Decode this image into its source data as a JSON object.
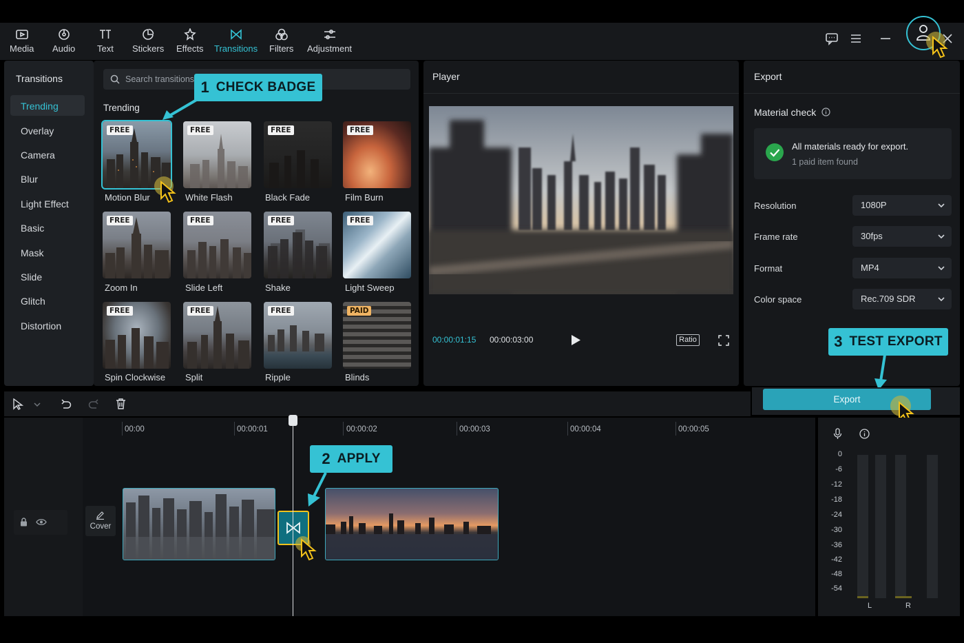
{
  "toolbar": {
    "items": [
      {
        "label": "Media",
        "icon": "media-icon",
        "active": false
      },
      {
        "label": "Audio",
        "icon": "audio-icon",
        "active": false
      },
      {
        "label": "Text",
        "icon": "text-icon",
        "active": false
      },
      {
        "label": "Stickers",
        "icon": "stickers-icon",
        "active": false
      },
      {
        "label": "Effects",
        "icon": "effects-icon",
        "active": false
      },
      {
        "label": "Transitions",
        "icon": "transitions-icon",
        "active": true
      },
      {
        "label": "Filters",
        "icon": "filters-icon",
        "active": false
      },
      {
        "label": "Adjustment",
        "icon": "adjustment-icon",
        "active": false
      }
    ],
    "accent_color": "#35c2d4"
  },
  "categories": {
    "title": "Transitions",
    "items": [
      "Trending",
      "Overlay",
      "Camera",
      "Blur",
      "Light Effect",
      "Basic",
      "Mask",
      "Slide",
      "Glitch",
      "Distortion"
    ],
    "active": "Trending"
  },
  "search": {
    "placeholder": "Search transitions"
  },
  "trending": {
    "title": "Trending",
    "items": [
      {
        "label": "Motion Blur",
        "badge": "FREE"
      },
      {
        "label": "White Flash",
        "badge": "FREE"
      },
      {
        "label": "Black Fade",
        "badge": "FREE"
      },
      {
        "label": "Film Burn",
        "badge": "FREE"
      },
      {
        "label": "Zoom In",
        "badge": "FREE"
      },
      {
        "label": "Slide Left",
        "badge": "FREE"
      },
      {
        "label": "Shake",
        "badge": "FREE"
      },
      {
        "label": "Light Sweep",
        "badge": "FREE"
      },
      {
        "label": "Spin Clockwise",
        "badge": "FREE"
      },
      {
        "label": "Split",
        "badge": "FREE"
      },
      {
        "label": "Ripple",
        "badge": "FREE"
      },
      {
        "label": "Blinds",
        "badge": "PAID"
      }
    ]
  },
  "player": {
    "title": "Player",
    "current_time": "00:00:01:15",
    "total_time": "00:00:03:00",
    "ratio_label": "Ratio"
  },
  "export": {
    "title": "Export",
    "material_check_title": "Material check",
    "status_main": "All materials ready for export.",
    "status_sub": "1 paid item found",
    "settings": [
      {
        "label": "Resolution",
        "value": "1080P"
      },
      {
        "label": "Frame rate",
        "value": "30fps"
      },
      {
        "label": "Format",
        "value": "MP4"
      },
      {
        "label": "Color space",
        "value": "Rec.709 SDR"
      }
    ],
    "button_label": "Export"
  },
  "callouts": {
    "c1": {
      "num": "1",
      "text": "CHECK BADGE"
    },
    "c2": {
      "num": "2",
      "text": "APPLY"
    },
    "c3": {
      "num": "3",
      "text": "TEST EXPORT"
    }
  },
  "timeline": {
    "ruler": [
      "00:00",
      "00:00:01",
      "00:00:02",
      "00:00:03",
      "00:00:04",
      "00:00:05"
    ],
    "cover_label": "Cover",
    "meter_db": [
      "0",
      "-6",
      "-12",
      "-18",
      "-24",
      "-30",
      "-36",
      "-42",
      "-48",
      "-54"
    ],
    "channels": [
      "L",
      "R"
    ]
  }
}
